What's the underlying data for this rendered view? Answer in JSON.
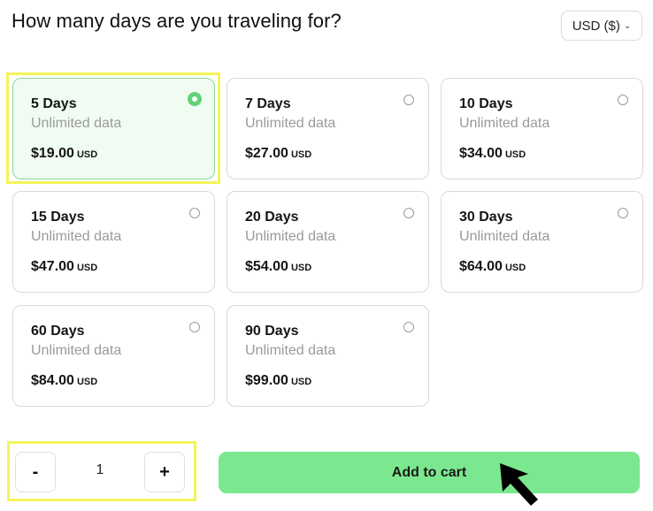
{
  "header": {
    "title": "How many days are you traveling for?",
    "currency_label": "USD ($)",
    "currency_chevron": "⌄"
  },
  "plans": [
    {
      "days": "5 Days",
      "data": "Unlimited data",
      "price": "$19.00",
      "currency": "USD",
      "selected": true
    },
    {
      "days": "7 Days",
      "data": "Unlimited data",
      "price": "$27.00",
      "currency": "USD",
      "selected": false
    },
    {
      "days": "10 Days",
      "data": "Unlimited data",
      "price": "$34.00",
      "currency": "USD",
      "selected": false
    },
    {
      "days": "15 Days",
      "data": "Unlimited data",
      "price": "$47.00",
      "currency": "USD",
      "selected": false
    },
    {
      "days": "20 Days",
      "data": "Unlimited data",
      "price": "$54.00",
      "currency": "USD",
      "selected": false
    },
    {
      "days": "30 Days",
      "data": "Unlimited data",
      "price": "$64.00",
      "currency": "USD",
      "selected": false
    },
    {
      "days": "60 Days",
      "data": "Unlimited data",
      "price": "$84.00",
      "currency": "USD",
      "selected": false
    },
    {
      "days": "90 Days",
      "data": "Unlimited data",
      "price": "$99.00",
      "currency": "USD",
      "selected": false
    }
  ],
  "quantity": {
    "minus_label": "-",
    "value": "1",
    "plus_label": "+"
  },
  "cart": {
    "add_label": "Add to cart"
  },
  "colors": {
    "accent": "#7be88f",
    "selected_bg": "#f0fcf2",
    "highlight": "#f4f45a"
  }
}
